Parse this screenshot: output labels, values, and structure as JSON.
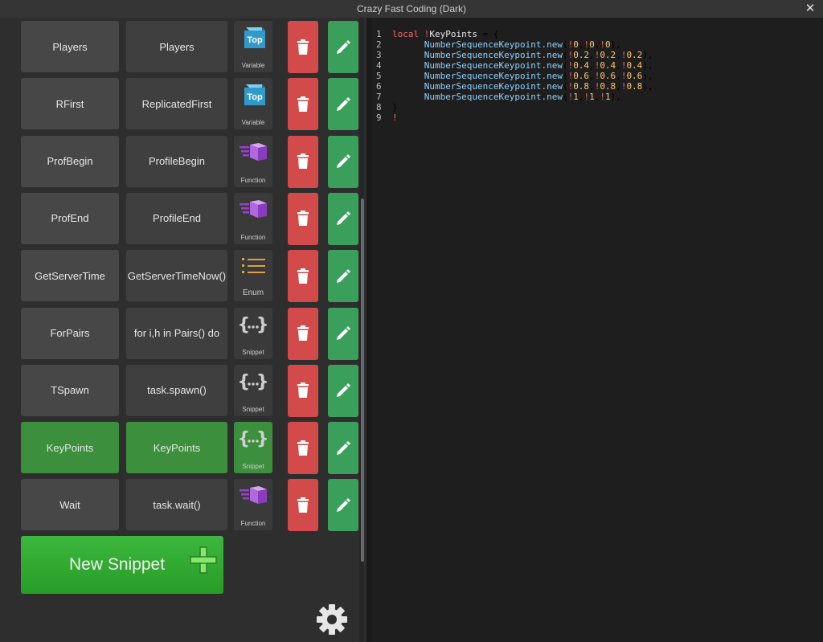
{
  "window": {
    "title": "Crazy Fast Coding (Dark)",
    "close_glyph": "✕"
  },
  "snippets": [
    {
      "shortcut": "Players",
      "full": "Players",
      "type": "Variable",
      "icon": "variable-icon",
      "selected": false
    },
    {
      "shortcut": "RFirst",
      "full": "ReplicatedFirst",
      "type": "Variable",
      "icon": "variable-icon",
      "selected": false
    },
    {
      "shortcut": "ProfBegin",
      "full": "ProfileBegin",
      "type": "Function",
      "icon": "function-icon",
      "selected": false
    },
    {
      "shortcut": "ProfEnd",
      "full": "ProfileEnd",
      "type": "Function",
      "icon": "function-icon",
      "selected": false
    },
    {
      "shortcut": "GetServerTime",
      "full": "GetServerTimeNow()",
      "type": "Enum",
      "icon": "enum-icon",
      "selected": false
    },
    {
      "shortcut": "ForPairs",
      "full": "for i,h in Pairs() do",
      "type": "Snippet",
      "icon": "snippet-icon",
      "selected": false
    },
    {
      "shortcut": "TSpawn",
      "full": "task.spawn()",
      "type": "Snippet",
      "icon": "snippet-icon",
      "selected": false
    },
    {
      "shortcut": "KeyPoints",
      "full": "KeyPoints",
      "type": "Snippet",
      "icon": "snippet-icon",
      "selected": true
    },
    {
      "shortcut": "Wait",
      "full": "task.wait()",
      "type": "Function",
      "icon": "function-icon",
      "selected": false
    }
  ],
  "variable_icon_text": "Top",
  "new_snippet_label": "New Snippet",
  "editor": {
    "line_numbers": [
      "1",
      "2",
      "3",
      "4",
      "5",
      "6",
      "7",
      "8",
      "9"
    ],
    "lines": [
      "local !KeyPoints = {",
      "      NumberSequenceKeypoint.new(!0,!0,!0),",
      "      NumberSequenceKeypoint.new(!0.2,!0.2,!0.2),",
      "      NumberSequenceKeypoint.new(!0.4,!0.4,!0.4),",
      "      NumberSequenceKeypoint.new(!0.6,!0.6,!0.6),",
      "      NumberSequenceKeypoint.new(!0.8,!0.8,!0.8),",
      "      NumberSequenceKeypoint.new(!1,!1,!1),",
      "}",
      "!"
    ]
  },
  "colors": {
    "delete": "#d34a4a",
    "edit": "#3a9f5b",
    "selected": "#3c8f3c",
    "new_button": "#33ad33",
    "function_purple": "#9b3fd0",
    "variable_blue": "#3aa6d0",
    "enum_gold": "#e0a23a"
  }
}
